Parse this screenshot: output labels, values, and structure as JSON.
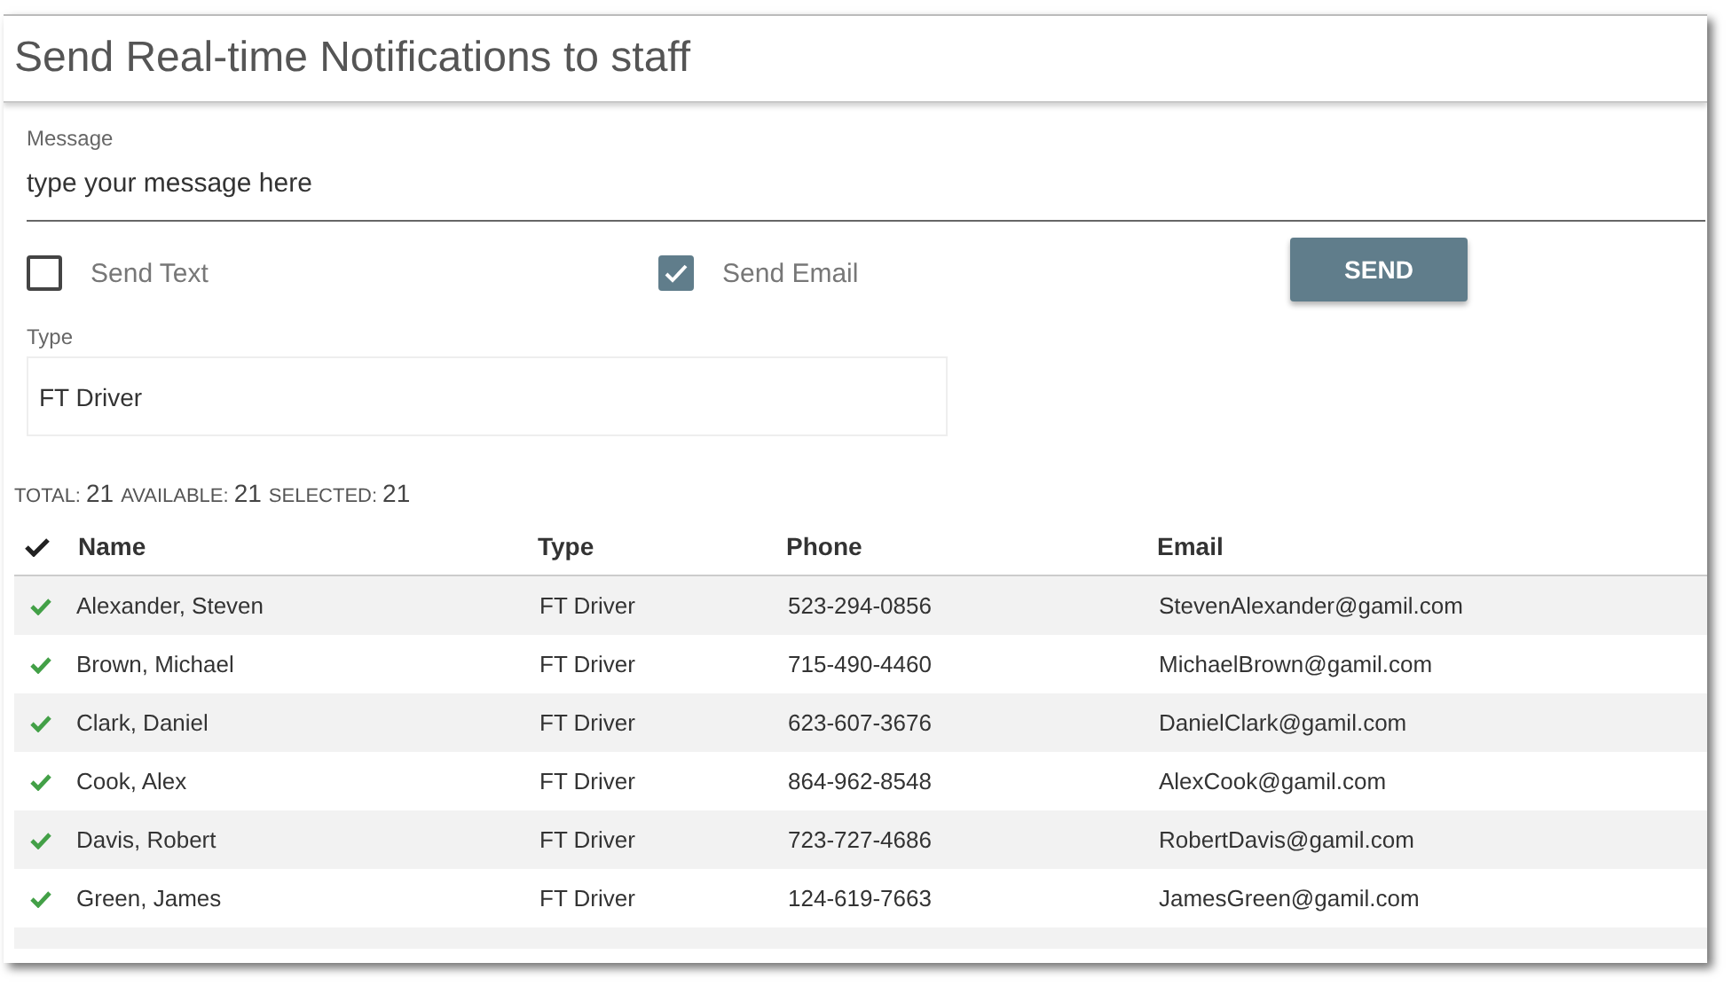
{
  "title": "Send Real-time Notifications to staff",
  "message": {
    "label": "Message",
    "placeholder": "type your message here"
  },
  "options": [
    {
      "label": "Send Text",
      "checked": false
    },
    {
      "label": "Send Email",
      "checked": true
    }
  ],
  "send_button": "SEND",
  "type_field": {
    "label": "Type",
    "value": "FT Driver"
  },
  "counts": [
    {
      "label": "TOTAL:",
      "value": "21"
    },
    {
      "label": "AVAILABLE:",
      "value": "21"
    },
    {
      "label": "SELECTED:",
      "value": "21"
    }
  ],
  "table": {
    "all_selected": true,
    "columns": [
      "Name",
      "Type",
      "Phone",
      "Email"
    ],
    "rows": [
      {
        "selected": true,
        "cells": [
          "Alexander, Steven",
          "FT Driver",
          "523-294-0856",
          "StevenAlexander@gamil.com"
        ]
      },
      {
        "selected": true,
        "cells": [
          "Brown, Michael",
          "FT Driver",
          "715-490-4460",
          "MichaelBrown@gamil.com"
        ]
      },
      {
        "selected": true,
        "cells": [
          "Clark, Daniel",
          "FT Driver",
          "623-607-3676",
          "DanielClark@gamil.com"
        ]
      },
      {
        "selected": true,
        "cells": [
          "Cook, Alex",
          "FT Driver",
          "864-962-8548",
          "AlexCook@gamil.com"
        ]
      },
      {
        "selected": true,
        "cells": [
          "Davis, Robert",
          "FT Driver",
          "723-727-4686",
          "RobertDavis@gamil.com"
        ]
      },
      {
        "selected": true,
        "cells": [
          "Green, James",
          "FT Driver",
          "124-619-7663",
          "JamesGreen@gamil.com"
        ]
      }
    ]
  }
}
